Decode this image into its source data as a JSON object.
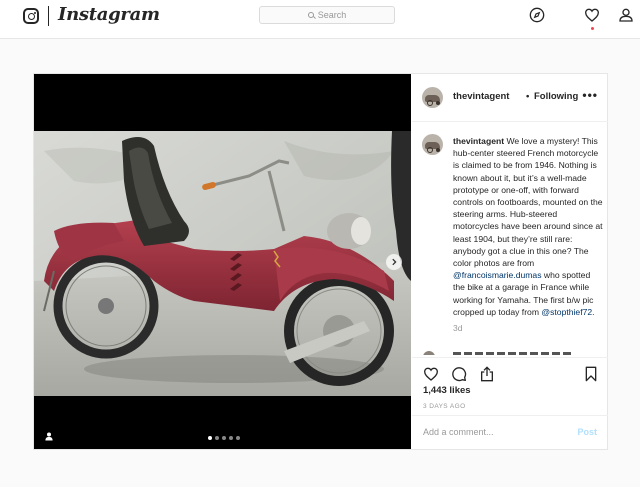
{
  "nav": {
    "brand": "Instagram",
    "search_placeholder": "Search",
    "icons": [
      "compass-icon",
      "heart-icon",
      "user-icon"
    ]
  },
  "post": {
    "username": "thevintagent",
    "separator": "•",
    "follow_status": "Following",
    "more": "•••",
    "caption": {
      "username": "thevintagent",
      "text_1": " We love a mystery! This hub-center steered French motorcycle is claimed to be from 1946. Nothing is known about it, but it’s a well-made prototype or one-off, with forward controls on footboards, mounted on the steering arms. Hub-steered motorcycles have been around since at least 1904, but they’re still rare: anybody got a clue in this one? The color photos are from ",
      "mention_1": "@francoismarie.dumas",
      "text_2": " who spotted the bike at a garage in France while working for Yamaha. The first b/w pic cropped up today from ",
      "mention_2": "@stopthief72",
      "text_3": ".",
      "time": "3d"
    },
    "likes": "1,443 likes",
    "posted_ago": "3 DAYS AGO",
    "comment_placeholder": "Add a comment...",
    "post_label": "Post",
    "carousel": {
      "slides": 5,
      "active": 1
    }
  },
  "colors": {
    "link": "#003569",
    "muted": "#999999",
    "notification": "#ed4956",
    "post_disabled": "#b2dffc"
  }
}
